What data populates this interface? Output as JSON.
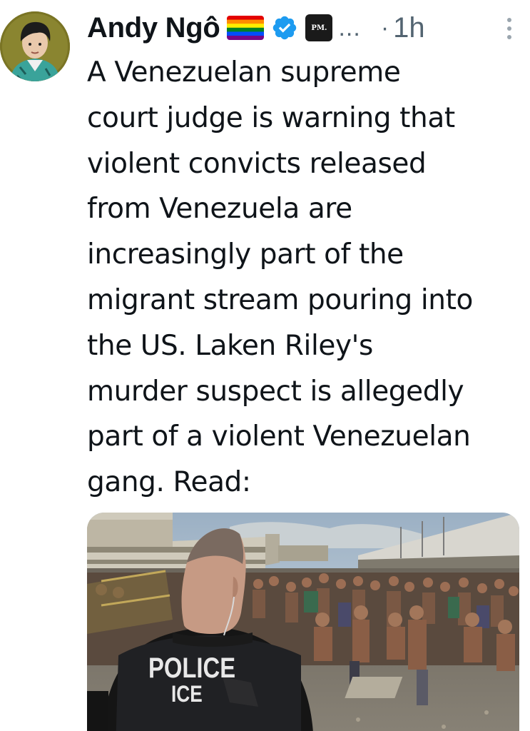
{
  "post": {
    "author_name": "Andy Ngô",
    "flag_icon": "rainbow-flag-icon",
    "verified_icon": "verified-badge-icon",
    "affiliate_badge": "PM.",
    "truncation": "...",
    "separator": "·",
    "timestamp": "1h",
    "more_icon": "more-vertical-icon",
    "text": "A Venezuelan supreme\ncourt judge is warning that\nviolent convicts released\nfrom Venezuela are\nincreasingly part of the\nmigrant stream pouring into\nthe US. Laken Riley's\nmurder suspect is allegedly\npart of a violent Venezuelan\ngang. Read:",
    "media": {
      "vest_line1": "POLICE",
      "vest_line2": "ICE"
    }
  },
  "colors": {
    "verified_blue": "#1d9bf0",
    "secondary_text": "#536471",
    "primary_text": "#0f1419"
  }
}
